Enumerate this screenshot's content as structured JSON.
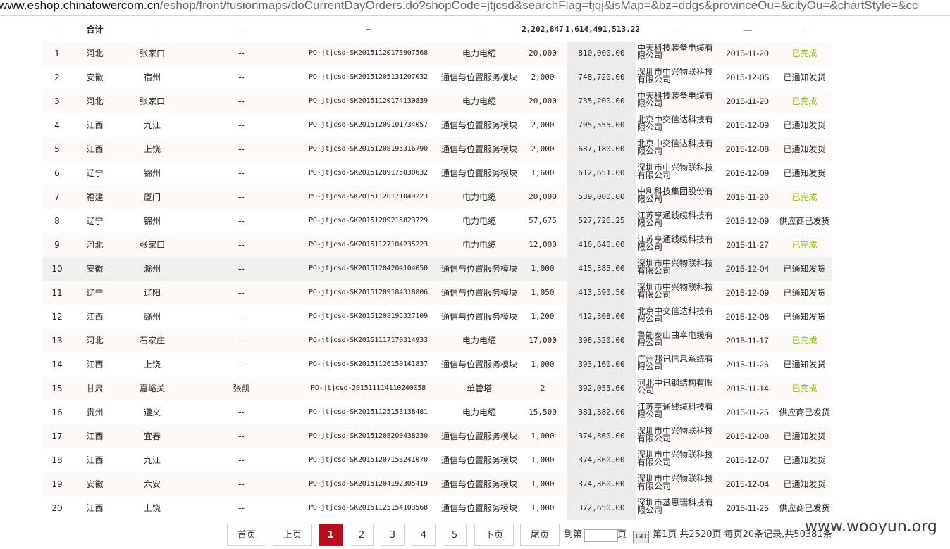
{
  "url": {
    "domain": "www.eshop.chinatowercom.cn",
    "path": "/eshop/front/fusionmaps/doCurrentDayOrders.do?shopCode=jtjcsd&searchFlag=tjqj&isMap=&bz=ddgs&provinceOu=&cityOu=&chartStyle=&cc"
  },
  "total": {
    "c0": "—",
    "c1": "合计",
    "c2": "—",
    "c3": "—",
    "c4": "—",
    "c5": "--",
    "qty": "2,202,847",
    "amount": "1,614,491,513.22",
    "c8": "—",
    "c9": "—",
    "c10": "--"
  },
  "rows": [
    {
      "no": "1",
      "prov": "河北",
      "city": "张家口",
      "contact": "--",
      "order": "PO-jtjcsd-SK20151120173907568",
      "item": "电力电缆",
      "qty": "20,000",
      "amount": "810,000.00",
      "vendor": "中天科技装备电缆有限公司",
      "date": "2015-11-20",
      "status": "已完成"
    },
    {
      "no": "2",
      "prov": "安徽",
      "city": "宿州",
      "contact": "--",
      "order": "PO-jtjcsd-SK20151205131207032",
      "item": "通信与位置服务模块",
      "qty": "2,000",
      "amount": "748,720.00",
      "vendor": "深圳市中兴物联科技有限公司",
      "date": "2015-12-05",
      "status": "已通知发货"
    },
    {
      "no": "3",
      "prov": "河北",
      "city": "张家口",
      "contact": "--",
      "order": "PO-jtjcsd-SK20151120174130839",
      "item": "电力电缆",
      "qty": "20,000",
      "amount": "735,200.00",
      "vendor": "中天科技装备电缆有限公司",
      "date": "2015-11-20",
      "status": "已完成"
    },
    {
      "no": "4",
      "prov": "江西",
      "city": "九江",
      "contact": "--",
      "order": "PO-jtjcsd-SK20151209101734057",
      "item": "通信与位置服务模块",
      "qty": "2,000",
      "amount": "705,555.00",
      "vendor": "北京中交信达科技有限公司",
      "date": "2015-12-09",
      "status": "已通知发货"
    },
    {
      "no": "5",
      "prov": "江西",
      "city": "上饶",
      "contact": "--",
      "order": "PO-jtjcsd-SK20151208195316790",
      "item": "通信与位置服务模块",
      "qty": "2,000",
      "amount": "687,180.00",
      "vendor": "北京中交信达科技有限公司",
      "date": "2015-12-08",
      "status": "已通知发货"
    },
    {
      "no": "6",
      "prov": "辽宁",
      "city": "锦州",
      "contact": "--",
      "order": "PO-jtjcsd-SK20151209175030632",
      "item": "通信与位置服务模块",
      "qty": "1,600",
      "amount": "612,651.00",
      "vendor": "深圳市中兴物联科技有限公司",
      "date": "2015-12-09",
      "status": "已通知发货"
    },
    {
      "no": "7",
      "prov": "福建",
      "city": "厦门",
      "contact": "--",
      "order": "PO-jtjcsd-SK20151120171049223",
      "item": "电力电缆",
      "qty": "20,000",
      "amount": "539,000.00",
      "vendor": "中利科技集团股份有限公司",
      "date": "2015-11-20",
      "status": "已完成"
    },
    {
      "no": "8",
      "prov": "辽宁",
      "city": "锦州",
      "contact": "--",
      "order": "PO-jtjcsd-SK20151209215823729",
      "item": "电力电缆",
      "qty": "57,675",
      "amount": "527,726.25",
      "vendor": "江苏亨通线缆科技有限公司",
      "date": "2015-12-09",
      "status": "供应商已发货"
    },
    {
      "no": "9",
      "prov": "河北",
      "city": "张家口",
      "contact": "--",
      "order": "PO-jtjcsd-SK20151127104235223",
      "item": "电力电缆",
      "qty": "12,000",
      "amount": "416,640.00",
      "vendor": "江苏亨通线缆科技有限公司",
      "date": "2015-11-27",
      "status": "已完成"
    },
    {
      "no": "10",
      "prov": "安徽",
      "city": "滁州",
      "contact": "--",
      "order": "PO-jtjcsd-SK20151204204104050",
      "item": "通信与位置服务模块",
      "qty": "1,000",
      "amount": "415,385.00",
      "vendor": "深圳市中兴物联科技有限公司",
      "date": "2015-12-04",
      "status": "已通知发货"
    },
    {
      "no": "11",
      "prov": "辽宁",
      "city": "辽阳",
      "contact": "--",
      "order": "PO-jtjcsd-SK20151209184318806",
      "item": "通信与位置服务模块",
      "qty": "1,050",
      "amount": "413,590.50",
      "vendor": "深圳市中兴物联科技有限公司",
      "date": "2015-12-09",
      "status": "已通知发货"
    },
    {
      "no": "12",
      "prov": "江西",
      "city": "赣州",
      "contact": "--",
      "order": "PO-jtjcsd-SK20151208195327109",
      "item": "通信与位置服务模块",
      "qty": "1,200",
      "amount": "412,308.00",
      "vendor": "北京中交信达科技有限公司",
      "date": "2015-12-08",
      "status": "已通知发货"
    },
    {
      "no": "13",
      "prov": "河北",
      "city": "石家庄",
      "contact": "--",
      "order": "PO-jtjcsd-SK20151117170314933",
      "item": "电力电缆",
      "qty": "17,000",
      "amount": "398,520.00",
      "vendor": "鲁能泰山曲阜电缆有限公司",
      "date": "2015-11-17",
      "status": "已完成"
    },
    {
      "no": "14",
      "prov": "江西",
      "city": "上饶",
      "contact": "--",
      "order": "PO-jtjcsd-SK20151126150141837",
      "item": "通信与位置服务模块",
      "qty": "1,000",
      "amount": "393,160.00",
      "vendor": "广州邦讯信息系统有限公司",
      "date": "2015-11-26",
      "status": "已通知发货"
    },
    {
      "no": "15",
      "prov": "甘肃",
      "city": "嘉峪关",
      "contact": "张凯",
      "order": "PO-jtjcsd-201511114110240058",
      "item": "单管塔",
      "qty": "2",
      "amount": "392,055.60",
      "vendor": "河北中讯钢结构有限公司",
      "date": "2015-11-14",
      "status": "已完成"
    },
    {
      "no": "16",
      "prov": "贵州",
      "city": "遵义",
      "contact": "--",
      "order": "PO-jtjcsd-SK20151125153138481",
      "item": "电力电缆",
      "qty": "15,500",
      "amount": "381,382.00",
      "vendor": "江苏亨通线缆科技有限公司",
      "date": "2015-11-25",
      "status": "供应商已发货"
    },
    {
      "no": "17",
      "prov": "江西",
      "city": "宜春",
      "contact": "--",
      "order": "PO-jtjcsd-SK20151208200438230",
      "item": "通信与位置服务模块",
      "qty": "1,000",
      "amount": "374,360.00",
      "vendor": "深圳市中兴物联科技有限公司",
      "date": "2015-12-08",
      "status": "已通知发货"
    },
    {
      "no": "18",
      "prov": "江西",
      "city": "九江",
      "contact": "--",
      "order": "PO-jtjcsd-SK20151207153241070",
      "item": "通信与位置服务模块",
      "qty": "1,000",
      "amount": "374,360.00",
      "vendor": "深圳市中兴物联科技有限公司",
      "date": "2015-12-07",
      "status": "已通知发货"
    },
    {
      "no": "19",
      "prov": "安徽",
      "city": "六安",
      "contact": "--",
      "order": "PO-jtjcsd-SK20151204192305419",
      "item": "通信与位置服务模块",
      "qty": "1,000",
      "amount": "374,360.00",
      "vendor": "深圳市中兴物联科技有限公司",
      "date": "2015-12-04",
      "status": "已通知发货"
    },
    {
      "no": "20",
      "prov": "江西",
      "city": "上饶",
      "contact": "--",
      "order": "PO-jtjcsd-SK20151125154103568",
      "item": "通信与位置服务模块",
      "qty": "1,000",
      "amount": "372,650.00",
      "vendor": "深圳市基思瑞科技有限公司",
      "date": "2015-11-25",
      "status": "供应商已发货"
    }
  ],
  "colors": {
    "done": "#8cb81f",
    "active_page": "#b8101a"
  },
  "pager": {
    "first": "首页",
    "prev": "上页",
    "pages": [
      "1",
      "2",
      "3",
      "4",
      "5"
    ],
    "current": "1",
    "next": "下页",
    "last": "尾页",
    "goto_prefix": "到第",
    "goto_suffix": "页",
    "go": "GO",
    "summary": "第1页 共2520页 每页20条记录,共50381条"
  },
  "watermark": "www.wooyun.org"
}
